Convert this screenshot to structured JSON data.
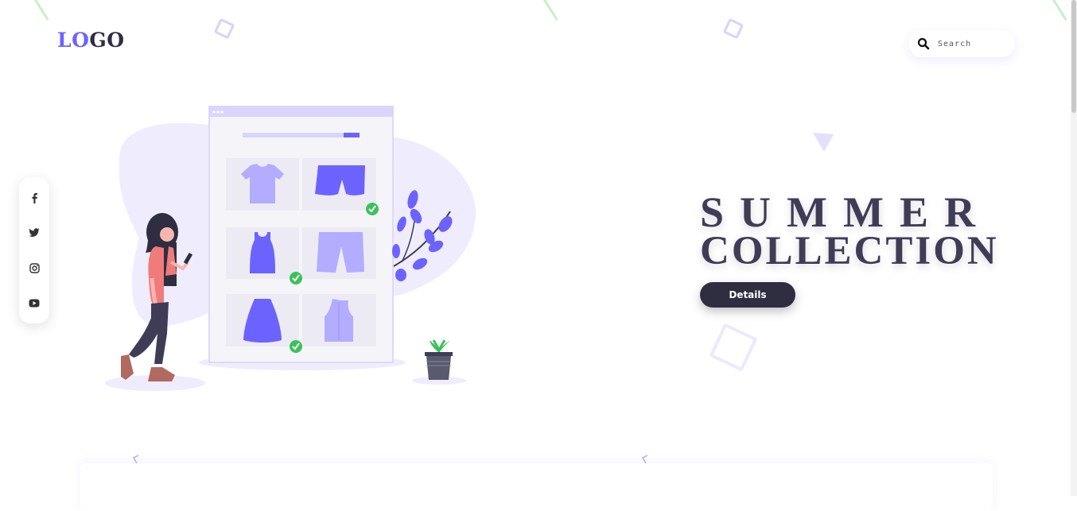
{
  "logo": {
    "part1": "LO",
    "part2": "GO"
  },
  "search": {
    "placeholder": "Search",
    "icon": "search-icon"
  },
  "social": [
    {
      "name": "facebook",
      "icon": "facebook-icon"
    },
    {
      "name": "twitter",
      "icon": "twitter-icon"
    },
    {
      "name": "instagram",
      "icon": "instagram-icon"
    },
    {
      "name": "youtube",
      "icon": "youtube-icon"
    }
  ],
  "hero": {
    "title_line1": "SUMMER",
    "title_line2": "COLLECTION",
    "button_label": "Details"
  },
  "colors": {
    "accent": "#6c63ff",
    "dark": "#2f2e41",
    "light_accent": "#b3acff",
    "check_green": "#3ac25a"
  }
}
